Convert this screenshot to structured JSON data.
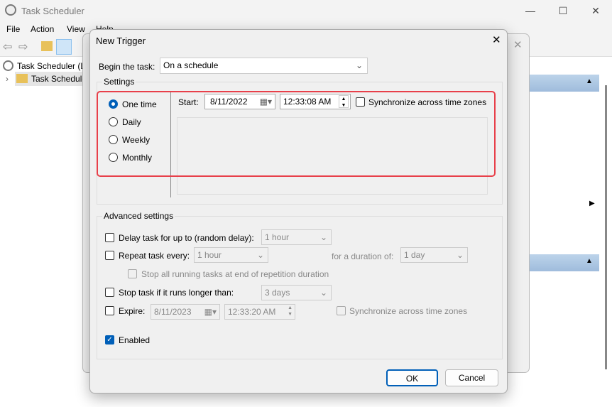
{
  "app": {
    "title": "Task Scheduler",
    "menu": [
      "File",
      "Action",
      "View",
      "Help"
    ],
    "tree": [
      "Task Scheduler (L",
      "Task Schedule"
    ]
  },
  "dialog": {
    "title": "New Trigger",
    "begin_label": "Begin the task:",
    "begin_value": "On a schedule",
    "settings_label": "Settings",
    "schedule_options": [
      {
        "label": "One time",
        "selected": true
      },
      {
        "label": "Daily",
        "selected": false
      },
      {
        "label": "Weekly",
        "selected": false
      },
      {
        "label": "Monthly",
        "selected": false
      }
    ],
    "start_label": "Start:",
    "start_date": "8/11/2022",
    "start_time": "12:33:08 AM",
    "sync_label": "Synchronize across time zones",
    "sync_checked": false,
    "advanced_label": "Advanced settings",
    "delay_label": "Delay task for up to (random delay):",
    "delay_value": "1 hour",
    "repeat_label": "Repeat task every:",
    "repeat_value": "1 hour",
    "duration_label": "for a duration of:",
    "duration_value": "1 day",
    "stop_all_label": "Stop all running tasks at end of repetition duration",
    "stop_longer_label": "Stop task if it runs longer than:",
    "stop_longer_value": "3 days",
    "expire_label": "Expire:",
    "expire_date": "8/11/2023",
    "expire_time": "12:33:20 AM",
    "expire_sync_label": "Synchronize across time zones",
    "enabled_label": "Enabled",
    "enabled_checked": true,
    "ok_label": "OK",
    "cancel_label": "Cancel"
  },
  "colors": {
    "accent": "#005fb8",
    "highlight": "#e81123"
  }
}
